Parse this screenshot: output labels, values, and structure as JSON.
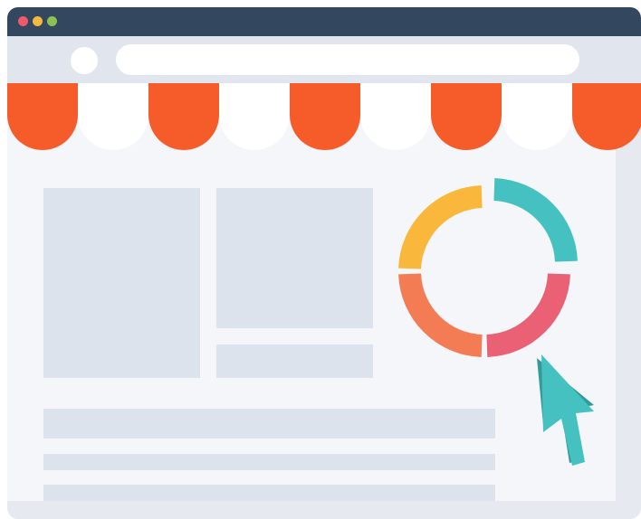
{
  "window": {
    "controls": [
      {
        "name": "close-dot",
        "color": "#ee5a6a"
      },
      {
        "name": "minimize-dot",
        "color": "#f5b942"
      },
      {
        "name": "maximize-dot",
        "color": "#8cc152"
      }
    ],
    "titlebar_color": "#33475f"
  },
  "awning": {
    "colors": [
      "#f65c2a",
      "#ffffff"
    ]
  },
  "donut_chart": {
    "segments": [
      {
        "name": "teal-segment",
        "color": "#46c1c2"
      },
      {
        "name": "pink-segment",
        "color": "#ea6074"
      },
      {
        "name": "orange-segment",
        "color": "#f37c55"
      },
      {
        "name": "yellow-segment",
        "color": "#f9b83c"
      }
    ]
  },
  "cursor": {
    "icon": "pointer-cursor-icon",
    "color": "#45c1c1",
    "shade": "#339a9a"
  }
}
